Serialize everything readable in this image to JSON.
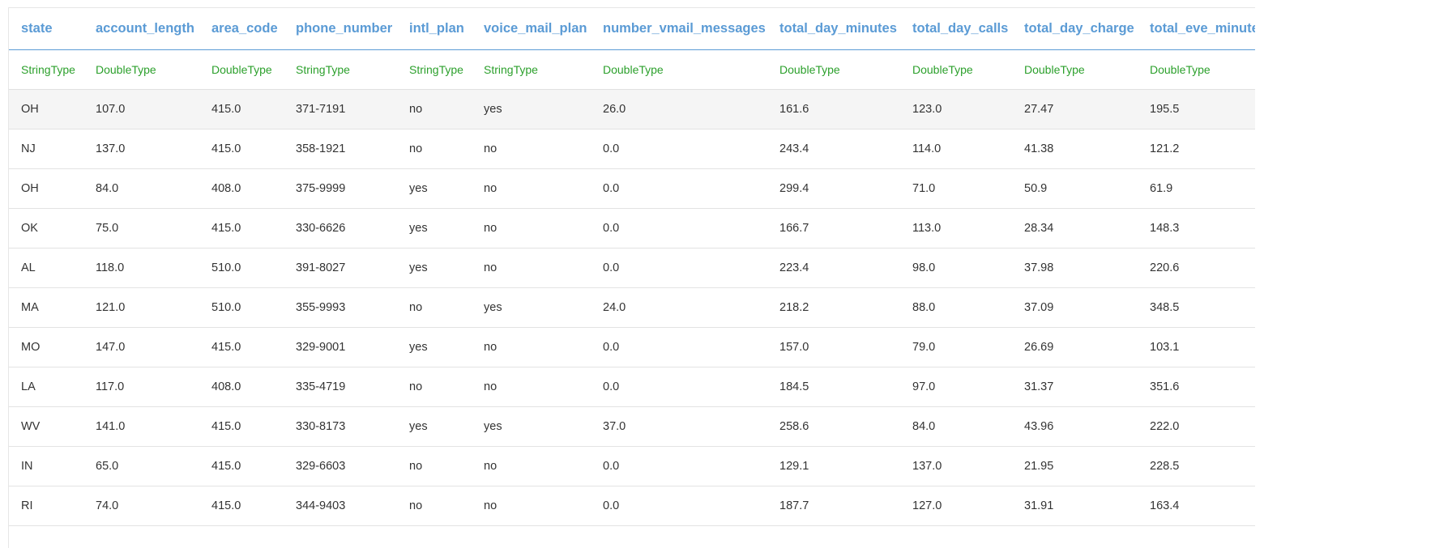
{
  "table": {
    "columns": [
      "state",
      "account_length",
      "area_code",
      "phone_number",
      "intl_plan",
      "voice_mail_plan",
      "number_vmail_messages",
      "total_day_minutes",
      "total_day_calls",
      "total_day_charge",
      "total_eve_minutes"
    ],
    "types": [
      "StringType",
      "DoubleType",
      "DoubleType",
      "StringType",
      "StringType",
      "StringType",
      "DoubleType",
      "DoubleType",
      "DoubleType",
      "DoubleType",
      "DoubleType"
    ],
    "rows": [
      [
        "OH",
        "107.0",
        "415.0",
        "371-7191",
        "no",
        "yes",
        "26.0",
        "161.6",
        "123.0",
        "27.47",
        "195.5"
      ],
      [
        "NJ",
        "137.0",
        "415.0",
        "358-1921",
        "no",
        "no",
        "0.0",
        "243.4",
        "114.0",
        "41.38",
        "121.2"
      ],
      [
        "OH",
        "84.0",
        "408.0",
        "375-9999",
        "yes",
        "no",
        "0.0",
        "299.4",
        "71.0",
        "50.9",
        "61.9"
      ],
      [
        "OK",
        "75.0",
        "415.0",
        "330-6626",
        "yes",
        "no",
        "0.0",
        "166.7",
        "113.0",
        "28.34",
        "148.3"
      ],
      [
        "AL",
        "118.0",
        "510.0",
        "391-8027",
        "yes",
        "no",
        "0.0",
        "223.4",
        "98.0",
        "37.98",
        "220.6"
      ],
      [
        "MA",
        "121.0",
        "510.0",
        "355-9993",
        "no",
        "yes",
        "24.0",
        "218.2",
        "88.0",
        "37.09",
        "348.5"
      ],
      [
        "MO",
        "147.0",
        "415.0",
        "329-9001",
        "yes",
        "no",
        "0.0",
        "157.0",
        "79.0",
        "26.69",
        "103.1"
      ],
      [
        "LA",
        "117.0",
        "408.0",
        "335-4719",
        "no",
        "no",
        "0.0",
        "184.5",
        "97.0",
        "31.37",
        "351.6"
      ],
      [
        "WV",
        "141.0",
        "415.0",
        "330-8173",
        "yes",
        "yes",
        "37.0",
        "258.6",
        "84.0",
        "43.96",
        "222.0"
      ],
      [
        "IN",
        "65.0",
        "415.0",
        "329-6603",
        "no",
        "no",
        "0.0",
        "129.1",
        "137.0",
        "21.95",
        "228.5"
      ],
      [
        "RI",
        "74.0",
        "415.0",
        "344-9403",
        "no",
        "no",
        "0.0",
        "187.7",
        "127.0",
        "31.91",
        "163.4"
      ]
    ],
    "highlight_row": 0
  },
  "colors": {
    "header_text": "#5b9bd5",
    "type_text": "#2ca02c",
    "cell_text": "#333333",
    "highlight_row_bg": "#f5f5f5"
  }
}
